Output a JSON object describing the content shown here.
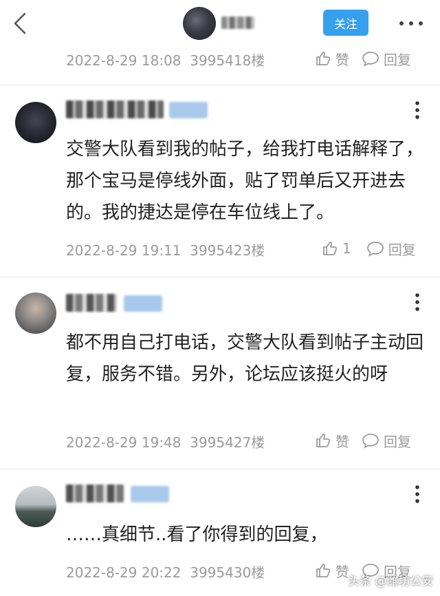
{
  "header": {
    "follow_label": "关注"
  },
  "comments": [
    {
      "date": "2022-8-29 18:08",
      "floor": "3995418楼",
      "like": "赞",
      "reply": "回复"
    },
    {
      "text": "交警大队看到我的帖子，给我打电话解释了，那个宝马是停线外面，贴了罚单后又开进去的。我的捷达是停在车位线上了。",
      "date": "2022-8-29 19:11",
      "floor": "3995423楼",
      "like": "1",
      "reply": "回复"
    },
    {
      "text": "都不用自己打电话，交警大队看到帖子主动回复，服务不错。另外，论坛应该挺火的呀",
      "date": "2022-8-29 19:48",
      "floor": "3995427楼",
      "like": "赞",
      "reply": "回复"
    },
    {
      "text": "……真细节..看了你得到的回复，",
      "date": "2022-8-29 20:22",
      "floor": "3995430楼",
      "like": "赞",
      "reply": "回复"
    }
  ],
  "watermark": "头条 @潍坊公安",
  "colors": {
    "accent": "#35a0ee",
    "meta": "#9b9b9b",
    "text": "#222222"
  },
  "icons": [
    "back-arrow-icon",
    "more-dots-icon",
    "thumb-up-icon",
    "reply-bubble-icon",
    "vertical-dots-icon"
  ]
}
